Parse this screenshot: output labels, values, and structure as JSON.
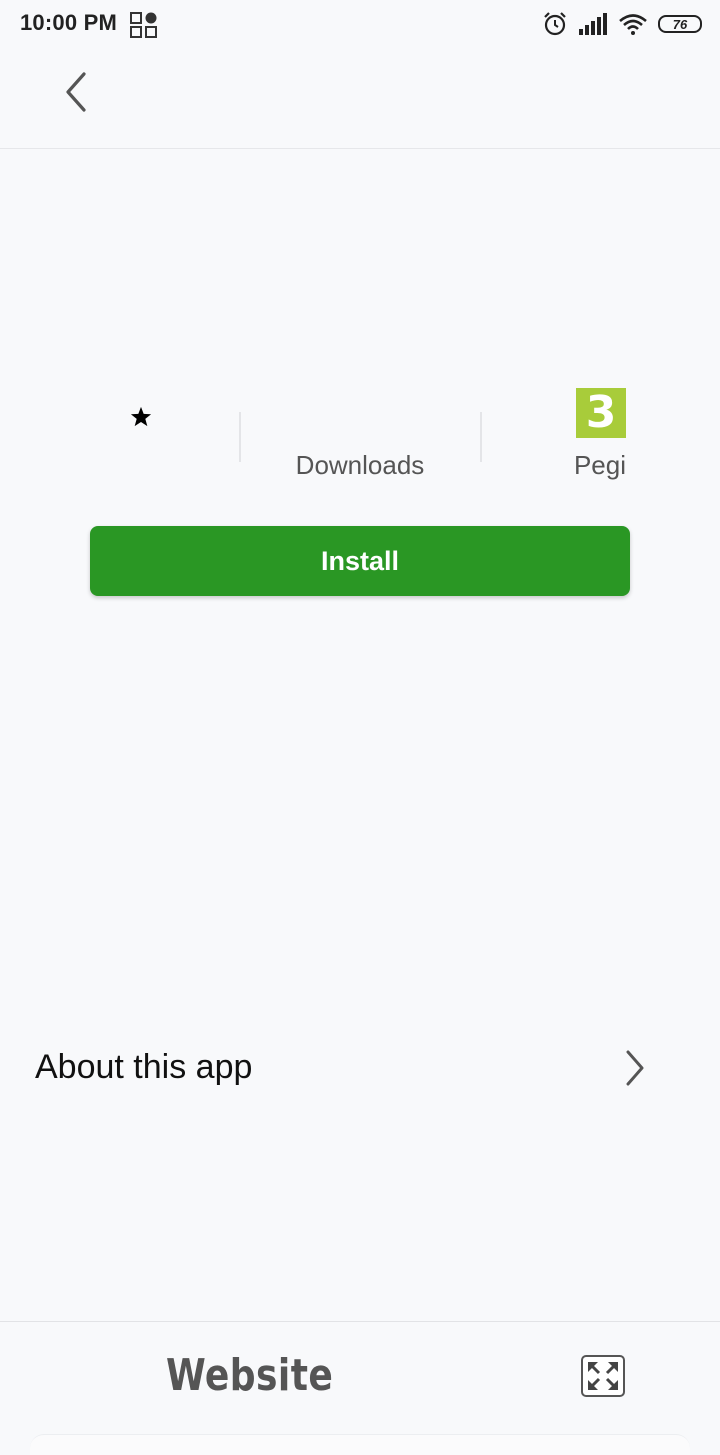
{
  "status_bar": {
    "time": "10:00 PM",
    "battery": "76",
    "icons": [
      "app-grid-icon",
      "alarm-icon",
      "signal-icon",
      "wifi-icon",
      "battery-icon"
    ]
  },
  "header": {
    "back_icon": "chevron-left-icon"
  },
  "stats": {
    "rating_icon": "star-icon",
    "downloads_label": "Downloads",
    "pegi_label": "Pegi",
    "pegi_rating": "3"
  },
  "install": {
    "label": "Install",
    "color": "#2a9724"
  },
  "about": {
    "title": "About this app",
    "chevron_icon": "chevron-right-icon"
  },
  "bottom_bar": {
    "label": "Website",
    "expand_icon": "expand-icon"
  }
}
